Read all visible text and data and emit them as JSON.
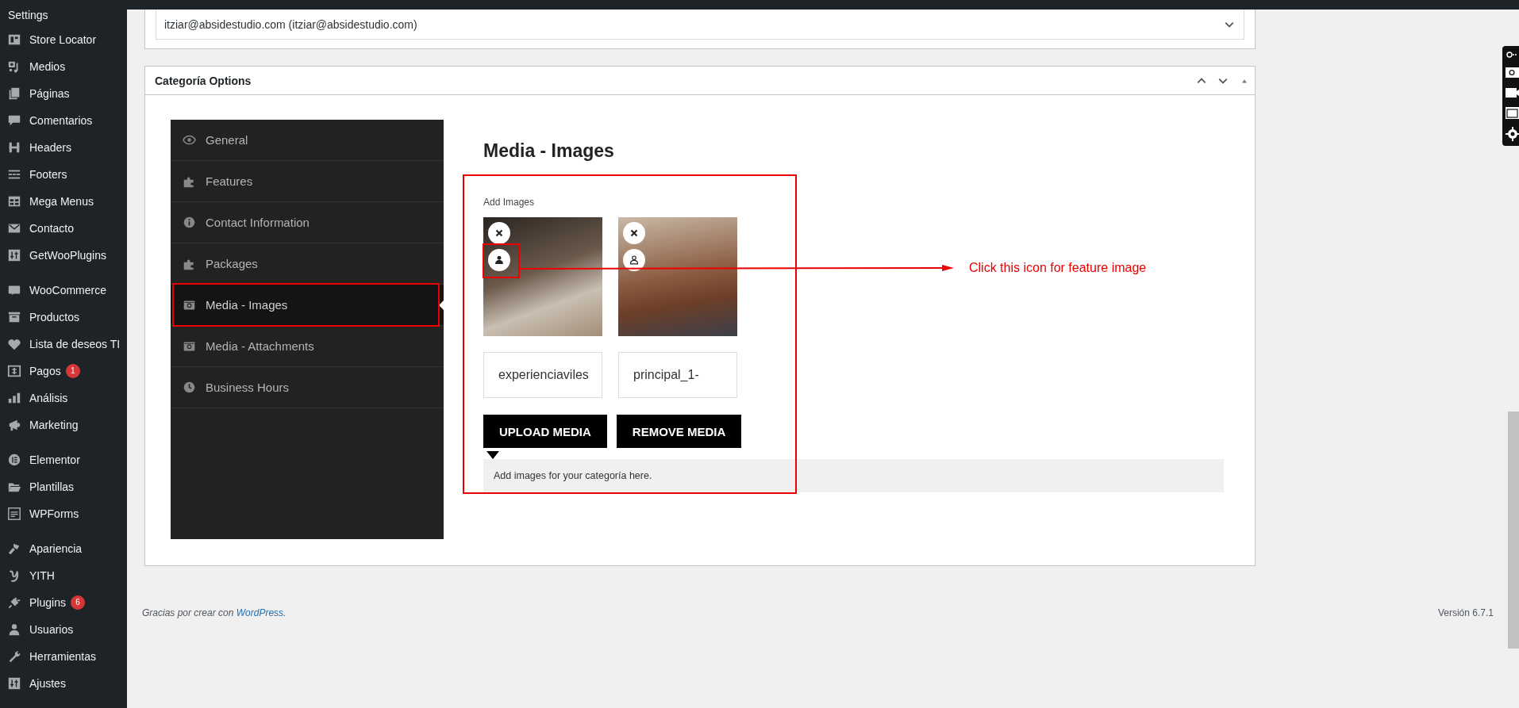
{
  "sidebar": {
    "heading": "Settings",
    "groups": [
      [
        {
          "label": "Store Locator"
        },
        {
          "label": "Medios"
        },
        {
          "label": "Páginas"
        },
        {
          "label": "Comentarios"
        },
        {
          "label": "Headers"
        },
        {
          "label": "Footers"
        },
        {
          "label": "Mega Menus"
        },
        {
          "label": "Contacto"
        },
        {
          "label": "GetWooPlugins"
        }
      ],
      [
        {
          "label": "WooCommerce"
        },
        {
          "label": "Productos"
        },
        {
          "label": "Lista de deseos TI"
        },
        {
          "label": "Pagos",
          "badge": "1"
        },
        {
          "label": "Análisis"
        },
        {
          "label": "Marketing"
        }
      ],
      [
        {
          "label": "Elementor"
        },
        {
          "label": "Plantillas"
        },
        {
          "label": "WPForms"
        }
      ],
      [
        {
          "label": "Apariencia"
        },
        {
          "label": "YITH"
        },
        {
          "label": "Plugins",
          "badge": "6"
        },
        {
          "label": "Usuarios"
        },
        {
          "label": "Herramientas"
        },
        {
          "label": "Ajustes"
        }
      ]
    ]
  },
  "author_select": {
    "value": "itziar@absidestudio.com (itziar@absidestudio.com)"
  },
  "metabox": {
    "title": "Categoría Options",
    "tabs": [
      {
        "label": "General",
        "selected": false
      },
      {
        "label": "Features",
        "selected": false
      },
      {
        "label": "Contact Information",
        "selected": false
      },
      {
        "label": "Packages",
        "selected": false
      },
      {
        "label": "Media - Images",
        "selected": true
      },
      {
        "label": "Media - Attachments",
        "selected": false
      },
      {
        "label": "Business Hours",
        "selected": false
      }
    ],
    "section_title": "Media - Images",
    "field_label": "Add Images",
    "images": [
      {
        "name": "experienciaviles",
        "featured": true
      },
      {
        "name": "principal_1-",
        "featured": false
      }
    ],
    "buttons": [
      "UPLOAD MEDIA",
      "REMOVE MEDIA"
    ],
    "help": "Add images for your categoría here."
  },
  "annotation": {
    "text": "Click this icon for feature image"
  },
  "footer": {
    "credit": "Gracias por crear con",
    "link": "WordPress",
    "credit_end": ".",
    "version": "Versión 6.7.1"
  }
}
